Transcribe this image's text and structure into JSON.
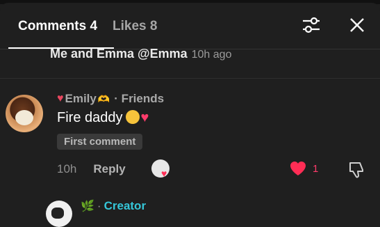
{
  "tabs": {
    "comments_label": "Comments 4",
    "likes_label": "Likes 8"
  },
  "icons": {
    "filter": "sliders-icon",
    "close": "close-icon",
    "like": "heart-icon",
    "dislike": "thumbs-down-icon"
  },
  "previous_reply": {
    "text": "Me and Emma @Emma",
    "time": "10h ago"
  },
  "comment": {
    "author": "Emily",
    "relation": "· Friends",
    "text": "Fire daddy",
    "badge": "First comment",
    "time": "10h",
    "reply_label": "Reply",
    "like_count": "1"
  },
  "next_comment": {
    "label": "Creator",
    "separator": "·"
  },
  "colors": {
    "background": "#1f1f1f",
    "like_red": "#ff3b6b",
    "creator_cyan": "#35c6d8"
  }
}
